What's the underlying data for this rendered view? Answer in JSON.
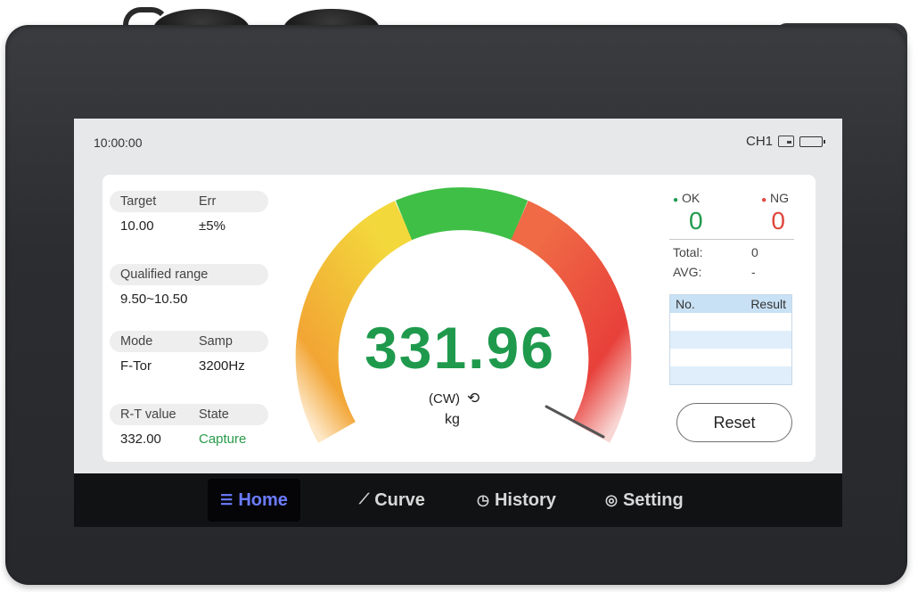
{
  "status": {
    "time": "10:00:00",
    "channel": "CH1"
  },
  "info": {
    "target_label": "Target",
    "err_label": "Err",
    "target_value": "10.00",
    "err_value": "±5%",
    "range_label": "Qualified range",
    "range_value": "9.50~10.50",
    "mode_label": "Mode",
    "samp_label": "Samp",
    "mode_value": "F-Tor",
    "samp_value": "3200Hz",
    "rt_label": "R-T value",
    "state_label": "State",
    "rt_value": "332.00",
    "state_value": "Capture"
  },
  "gauge": {
    "value": "331.96",
    "direction": "(CW)",
    "unit": "kg",
    "colors": [
      "#f0a227",
      "#f3d83c",
      "#3cbf48",
      "#ea5a3d",
      "#e83a35"
    ]
  },
  "stats": {
    "ok_label": "OK",
    "ng_label": "NG",
    "ok_count": "0",
    "ng_count": "0",
    "total_label": "Total:",
    "total_value": "0",
    "avg_label": "AVG:",
    "avg_value": "-"
  },
  "results_table": {
    "col_no": "No.",
    "col_result": "Result"
  },
  "reset_label": "Reset",
  "nav": {
    "home": "Home",
    "curve": "Curve",
    "history": "History",
    "setting": "Setting"
  }
}
